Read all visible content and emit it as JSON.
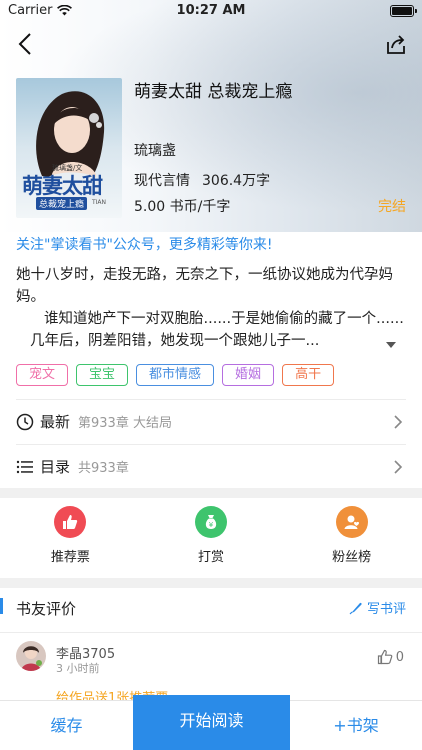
{
  "status_bar": {
    "carrier": "Carrier",
    "time": "10:27 AM"
  },
  "book": {
    "title": "萌妻太甜 总裁宠上瘾",
    "author": "琉璃盏",
    "genre": "现代言情",
    "word_count": "306.4万字",
    "price": "5.00 书币/千字",
    "status": "完结",
    "cover": {
      "title_text": "萌妻太甜",
      "subtitle_text": "总裁宠上瘾",
      "author_text": "琉璃盏/文",
      "tian_text": "TIAN"
    }
  },
  "notice": "关注\"掌读看书\"公众号，更多精彩等你来!",
  "intro": {
    "line1": "她十八岁时，走投无路，无奈之下，一纸协议她成为代孕妈妈。",
    "line2": "谁知道她产下一对双胞胎......于是她偷偷的藏了一个......",
    "line3": "几年后，阴差阳错，她发现一个跟她儿子一..."
  },
  "tags": [
    {
      "label": "宠文",
      "color": "#f06fa8"
    },
    {
      "label": "宝宝",
      "color": "#3ec46d"
    },
    {
      "label": "都市情感",
      "color": "#4a8fe0"
    },
    {
      "label": "婚姻",
      "color": "#b56ee0"
    },
    {
      "label": "高干",
      "color": "#f0774d"
    }
  ],
  "latest": {
    "label": "最新",
    "chapter": "第933章 大结局"
  },
  "catalog": {
    "label": "目录",
    "count": "共933章"
  },
  "actions": [
    {
      "label": "推荐票",
      "icon": "thumbs-up-icon",
      "color": "#f04b54"
    },
    {
      "label": "打赏",
      "icon": "money-bag-icon",
      "color": "#3ec46d"
    },
    {
      "label": "粉丝榜",
      "icon": "fans-icon",
      "color": "#f0903a"
    }
  ],
  "reviews": {
    "title": "书友评价",
    "write_label": "写书评",
    "items": [
      {
        "name": "李晶3705",
        "time": "3 小时前",
        "likes": "0",
        "text": "给作品送1张推荐票"
      }
    ]
  },
  "bottom_bar": {
    "cache": "缓存",
    "read": "开始阅读",
    "shelf": "+书架"
  },
  "colors": {
    "accent": "#2a8be8",
    "status": "#f5a623"
  }
}
